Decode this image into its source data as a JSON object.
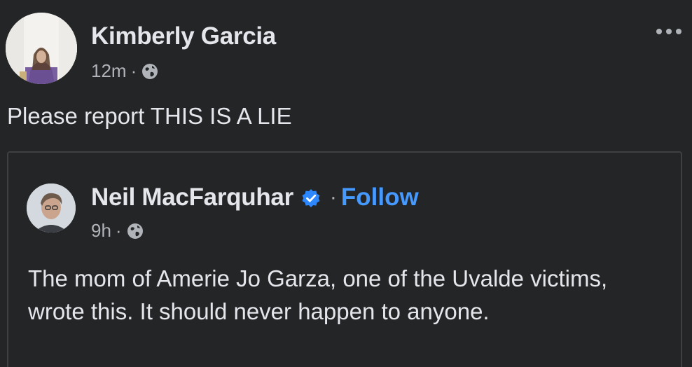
{
  "post": {
    "author": "Kimberly Garcia",
    "time": "12m",
    "separator": "·",
    "privacy_icon": "globe-icon",
    "more_icon": "more-horizontal-icon",
    "text": "Please report THIS IS A LIE"
  },
  "shared_post": {
    "author": "Neil MacFarquhar",
    "verified_icon": "verified-badge-icon",
    "separator": "·",
    "follow_label": "Follow",
    "time": "9h",
    "privacy_icon": "globe-icon",
    "text": "The mom of Amerie Jo Garza, one of the Uvalde victims,  wrote this. It should never happen to anyone."
  },
  "colors": {
    "background": "#242526",
    "primary_text": "#e4e6eb",
    "secondary_text": "#b0b3b8",
    "link_blue": "#4599ff",
    "verified_blue": "#2d88ff",
    "border": "#3e4042"
  }
}
